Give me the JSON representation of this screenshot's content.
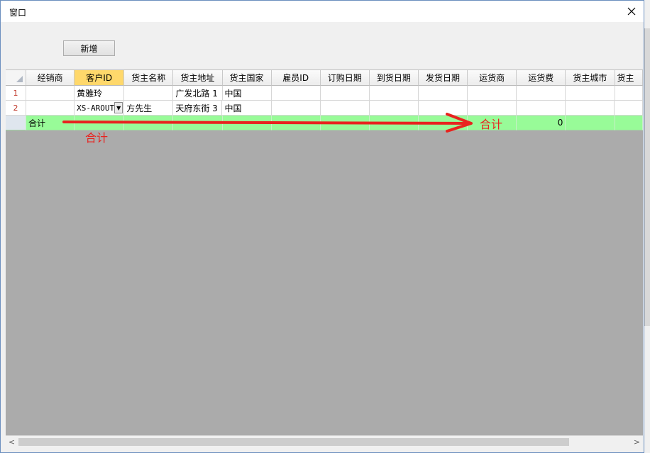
{
  "window": {
    "title": "窗口",
    "close_glyph": "✕"
  },
  "toolbar": {
    "add_label": "新增"
  },
  "grid": {
    "columns": [
      "经销商",
      "客户ID",
      "货主名称",
      "货主地址",
      "货主国家",
      "雇员ID",
      "订购日期",
      "到货日期",
      "发货日期",
      "运货商",
      "运货费",
      "货主城市",
      "货主"
    ],
    "active_column": "客户ID",
    "rows": [
      {
        "num": "1",
        "cells": [
          "",
          "黄雅玲",
          "",
          "广发北路 1",
          "中国",
          "",
          "",
          "",
          "",
          "",
          "",
          "",
          ""
        ]
      },
      {
        "num": "2",
        "cells": [
          "",
          "XS-AROUT",
          "方先生",
          "天府东街 3",
          "中国",
          "",
          "",
          "",
          "",
          "",
          "",
          "",
          ""
        ]
      }
    ],
    "summary": {
      "label": "合计",
      "freight_total": "0"
    }
  },
  "annotations": {
    "left_label": "合计",
    "right_label": "合计",
    "color": "#e8231f"
  },
  "colors": {
    "summary_row": "#98fb98",
    "active_header": "#ffd86b",
    "empty_area": "#ababab"
  }
}
